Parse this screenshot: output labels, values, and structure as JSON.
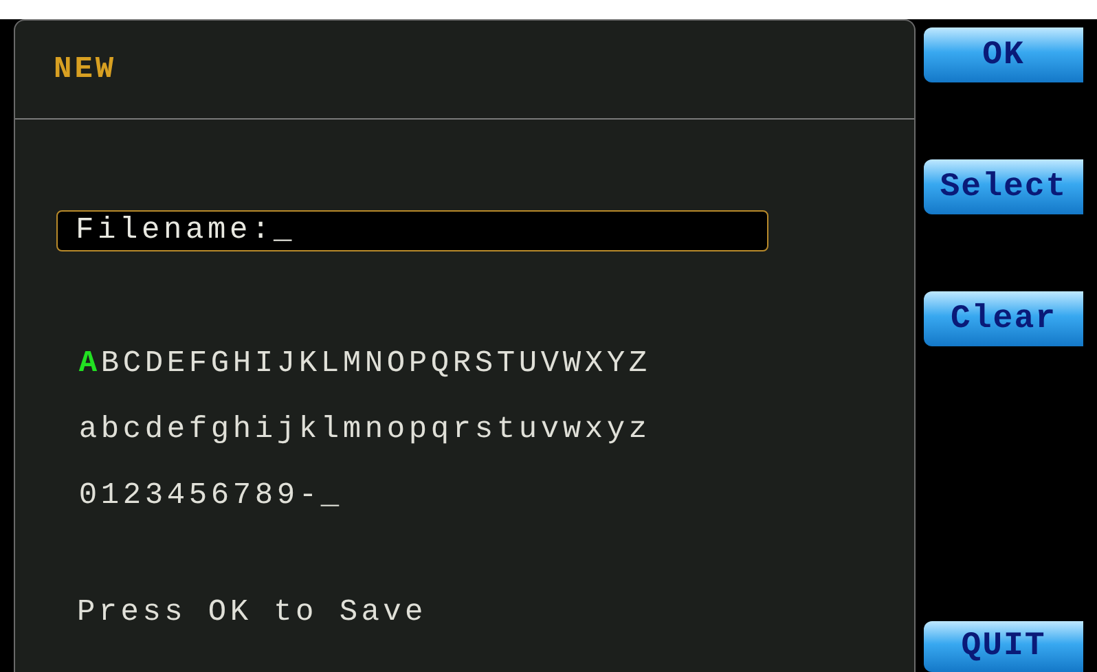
{
  "dialog": {
    "title": "NEW",
    "filename_field": {
      "value": "Filename:_"
    },
    "keyboard": [
      {
        "keys": [
          {
            "char": "A",
            "selected": true
          },
          {
            "char": "B",
            "selected": false
          },
          {
            "char": "C",
            "selected": false
          },
          {
            "char": "D",
            "selected": false
          },
          {
            "char": "E",
            "selected": false
          },
          {
            "char": "F",
            "selected": false
          },
          {
            "char": "G",
            "selected": false
          },
          {
            "char": "H",
            "selected": false
          },
          {
            "char": "I",
            "selected": false
          },
          {
            "char": "J",
            "selected": false
          },
          {
            "char": "K",
            "selected": false
          },
          {
            "char": "L",
            "selected": false
          },
          {
            "char": "M",
            "selected": false
          },
          {
            "char": "N",
            "selected": false
          },
          {
            "char": "O",
            "selected": false
          },
          {
            "char": "P",
            "selected": false
          },
          {
            "char": "Q",
            "selected": false
          },
          {
            "char": "R",
            "selected": false
          },
          {
            "char": "S",
            "selected": false
          },
          {
            "char": "T",
            "selected": false
          },
          {
            "char": "U",
            "selected": false
          },
          {
            "char": "V",
            "selected": false
          },
          {
            "char": "W",
            "selected": false
          },
          {
            "char": "X",
            "selected": false
          },
          {
            "char": "Y",
            "selected": false
          },
          {
            "char": "Z",
            "selected": false
          }
        ]
      },
      {
        "keys": [
          {
            "char": "a",
            "selected": false
          },
          {
            "char": "b",
            "selected": false
          },
          {
            "char": "c",
            "selected": false
          },
          {
            "char": "d",
            "selected": false
          },
          {
            "char": "e",
            "selected": false
          },
          {
            "char": "f",
            "selected": false
          },
          {
            "char": "g",
            "selected": false
          },
          {
            "char": "h",
            "selected": false
          },
          {
            "char": "i",
            "selected": false
          },
          {
            "char": "j",
            "selected": false
          },
          {
            "char": "k",
            "selected": false
          },
          {
            "char": "l",
            "selected": false
          },
          {
            "char": "m",
            "selected": false
          },
          {
            "char": "n",
            "selected": false
          },
          {
            "char": "o",
            "selected": false
          },
          {
            "char": "p",
            "selected": false
          },
          {
            "char": "q",
            "selected": false
          },
          {
            "char": "r",
            "selected": false
          },
          {
            "char": "s",
            "selected": false
          },
          {
            "char": "t",
            "selected": false
          },
          {
            "char": "u",
            "selected": false
          },
          {
            "char": "v",
            "selected": false
          },
          {
            "char": "w",
            "selected": false
          },
          {
            "char": "x",
            "selected": false
          },
          {
            "char": "y",
            "selected": false
          },
          {
            "char": "z",
            "selected": false
          }
        ]
      },
      {
        "keys": [
          {
            "char": "0",
            "selected": false
          },
          {
            "char": "1",
            "selected": false
          },
          {
            "char": "2",
            "selected": false
          },
          {
            "char": "3",
            "selected": false
          },
          {
            "char": "4",
            "selected": false
          },
          {
            "char": "5",
            "selected": false
          },
          {
            "char": "6",
            "selected": false
          },
          {
            "char": "7",
            "selected": false
          },
          {
            "char": "8",
            "selected": false
          },
          {
            "char": "9",
            "selected": false
          },
          {
            "char": "-",
            "selected": false
          },
          {
            "char": "_",
            "selected": false
          }
        ]
      }
    ],
    "hint": "Press OK to Save"
  },
  "softkeys": [
    {
      "label": "OK"
    },
    {
      "label": "Select"
    },
    {
      "label": "Clear"
    },
    {
      "label": "QUIT"
    }
  ]
}
